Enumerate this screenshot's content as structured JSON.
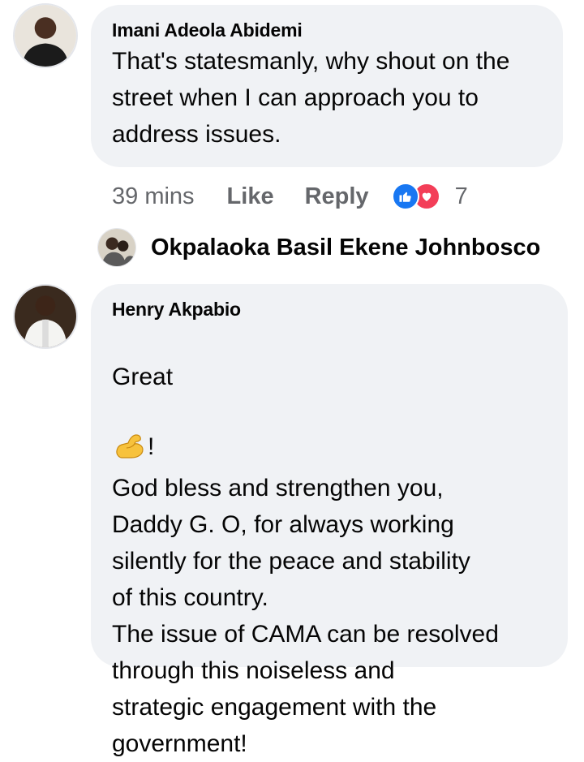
{
  "comments": [
    {
      "author": "Imani Adeola Abidemi",
      "text": "That's statesmanly, why shout on the street when I can approach you to address issues.",
      "meta": {
        "time": "39 mins",
        "like_label": "Like",
        "reply_label": "Reply",
        "reactions": [
          "like-icon",
          "love-icon"
        ],
        "reaction_count": "7"
      },
      "replies_preview": {
        "author": "Okpalaoka Basil Ekene Johnbosco"
      }
    },
    {
      "author": "Henry Akpabio",
      "text_line1_before": "Great",
      "text_line1_emoji": "flexed-biceps-icon",
      "text_line1_after": "!",
      "text_rest": "God bless and strengthen you,\nDaddy G. O, for always working\nsilently for the peace and stability\nof this country.\nThe issue of CAMA can be resolved\nthrough this noiseless and\nstrategic engagement with the\ngovernment!"
    }
  ],
  "colors": {
    "bubble": "#f0f2f5",
    "meta_text": "#65676b",
    "like_blue": "#1877f2",
    "love_red": "#f33e58"
  }
}
